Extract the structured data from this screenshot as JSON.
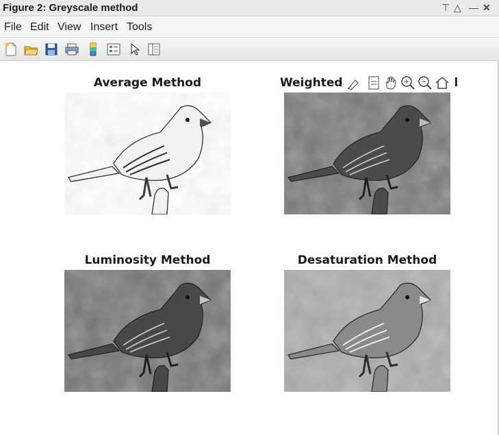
{
  "window": {
    "title": "Figure 2: Greyscale method",
    "controls": {
      "pin": "⊤",
      "maximize": "△",
      "minimize": "—",
      "close": "✕"
    }
  },
  "menu": [
    "File",
    "Edit",
    "View",
    "Insert",
    "Tools"
  ],
  "toolbar": [
    "new-figure-icon",
    "open-file-icon",
    "save-icon",
    "print-icon",
    "colorbar-icon",
    "legend-icon",
    "edit-plot-icon",
    "property-inspector-icon"
  ],
  "axes_toolbar": [
    "brush-icon",
    "datatip-icon",
    "pan-icon",
    "zoom-in-icon",
    "zoom-out-icon",
    "restore-view-icon"
  ],
  "panels": [
    {
      "title": "Average Method",
      "tone": "light"
    },
    {
      "title": "Weighted ...d",
      "title_visible_left": "Weighted",
      "title_visible_right": "d",
      "tone": "mid"
    },
    {
      "title": "Luminosity Method",
      "tone": "mid"
    },
    {
      "title": "Desaturation Method",
      "tone": "bright"
    }
  ],
  "colors": {
    "titlebar": "#e9eaec",
    "menubar": "#f5f5f5",
    "figure_bg": "#ffffff"
  }
}
